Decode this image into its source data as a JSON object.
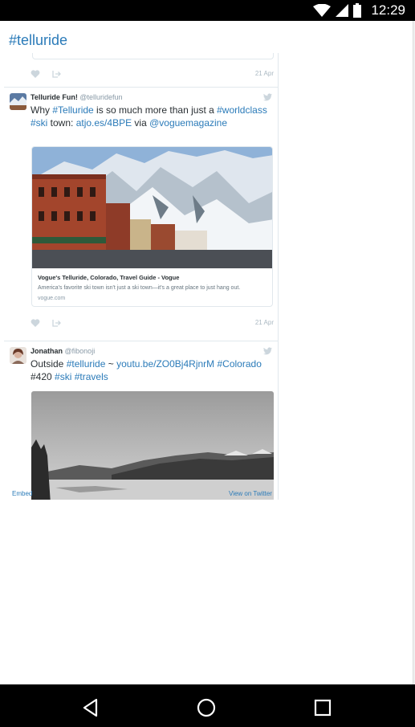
{
  "status_bar": {
    "time": "12:29",
    "icons": [
      "wifi-icon",
      "cell-signal-icon",
      "battery-icon"
    ]
  },
  "header": {
    "title": "#telluride"
  },
  "previous_tweet": {
    "date": "21 Apr"
  },
  "tweets": [
    {
      "author_name": "Telluride Fun!",
      "author_handle": "@telluridefun",
      "text_segments": [
        "Why ",
        "#Telluride",
        " is so much more than just a ",
        "#worldclass",
        "#ski",
        " town: ",
        "atjo.es/4BPE",
        " via ",
        "@voguemagazine"
      ],
      "card": {
        "title": "Vogue's Telluride, Colorado, Travel Guide - Vogue",
        "description": "America's favorite ski town isn't just a ski town—it's a great place to just hang out.",
        "domain": "vogue.com"
      },
      "date": "21 Apr"
    },
    {
      "author_name": "Jonathan",
      "author_handle": "@fibonoji",
      "text_segments": [
        "Outside ",
        "#telluride",
        " ~ ",
        "youtu.be/ZO0Bj4RjnrM",
        " ",
        "#Colorado",
        "#420 ",
        "#ski",
        " ",
        "#travels"
      ]
    }
  ],
  "footer": {
    "embed_label": "Embed",
    "view_label": "View on Twitter"
  },
  "nav": {
    "buttons": [
      "back-icon",
      "home-icon",
      "recents-icon"
    ]
  },
  "colors": {
    "link": "#2b7bb9",
    "status_bar": "#000000",
    "border": "#e1e8ed"
  }
}
